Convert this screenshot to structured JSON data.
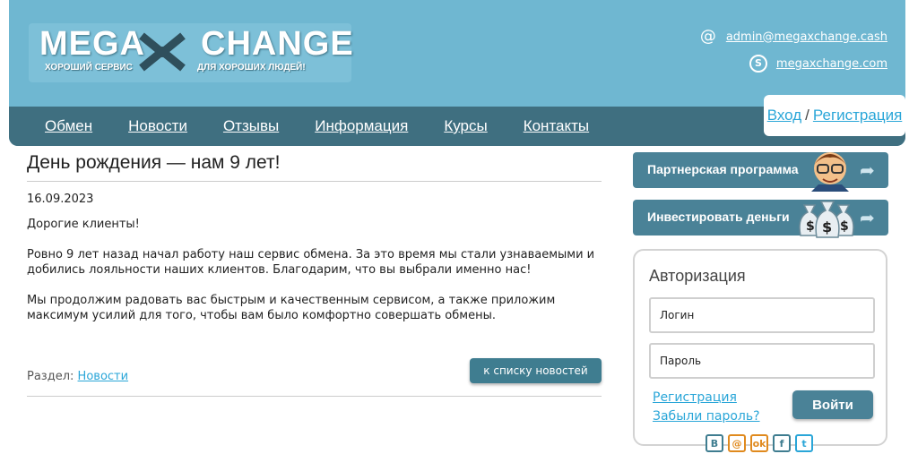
{
  "header": {
    "logo": {
      "left": "MEGA",
      "right": "CHANGE",
      "slogan_left": "ХОРОШИЙ СЕРВИС",
      "slogan_right": "ДЛЯ ХОРОШИХ ЛЮДЕЙ!"
    },
    "email": "admin@megaxchange.cash",
    "skype": "megaxchange.com",
    "email_icon": "at-icon",
    "skype_icon": "skype-icon",
    "auth": {
      "login": "Вход",
      "separator": "/",
      "register": "Регистрация"
    }
  },
  "nav": {
    "items": [
      {
        "label": "Обмен"
      },
      {
        "label": "Новости"
      },
      {
        "label": "Отзывы"
      },
      {
        "label": "Информация"
      },
      {
        "label": "Курсы"
      },
      {
        "label": "Контакты"
      }
    ]
  },
  "article": {
    "title": "День рождения — нам 9 лет!",
    "date": "16.09.2023",
    "paragraphs": [
      "Дорогие клиенты!",
      "Ровно 9 лет назад начал работу наш сервис обмена. За это время мы стали узнаваемыми и добились лояльности наших клиентов. Благодарим, что вы выбрали именно нас!",
      "Мы продолжим радовать вас быстрым и качественным сервисом, а также приложим максимум усилий для того, чтобы вам было комфортно совершать обмены."
    ],
    "section_label": "Раздел:",
    "section_link": "Новости",
    "back_button": "к списку новостей"
  },
  "sidebar": {
    "banners": [
      {
        "label": "Партнерская программа",
        "icon": "partner-man-icon"
      },
      {
        "label": "Инвестировать деньги",
        "icon": "money-bags-icon"
      }
    ],
    "login": {
      "title": "Авторизация",
      "login_placeholder": "Логин",
      "password_placeholder": "Пароль",
      "register_link": "Регистрация",
      "forgot_link": "Забыли пароль?",
      "submit": "Войти"
    },
    "socials": [
      {
        "label": "В",
        "name": "vk-icon"
      },
      {
        "label": "@",
        "name": "mail-icon"
      },
      {
        "label": "ok",
        "name": "odnoklassniki-icon"
      },
      {
        "label": "f",
        "name": "facebook-icon"
      },
      {
        "label": "t",
        "name": "twitter-icon"
      }
    ]
  },
  "colors": {
    "header": "#6fb7d1",
    "navbar": "#3f6f80",
    "link": "#2aa6d8",
    "button": "#4a8297"
  }
}
